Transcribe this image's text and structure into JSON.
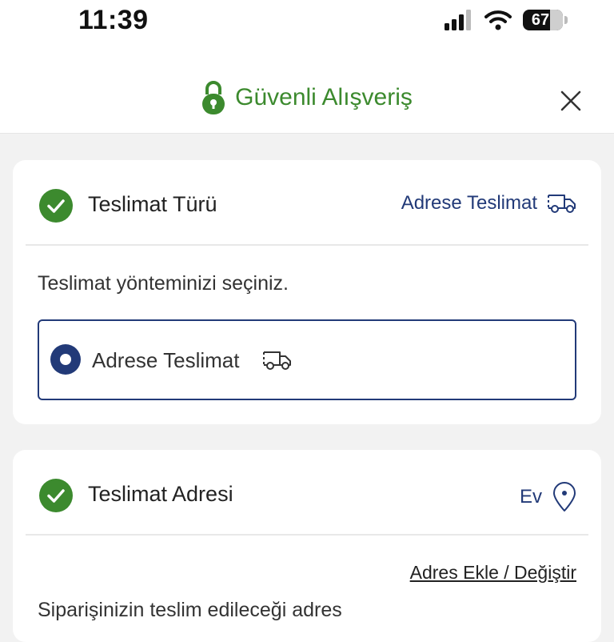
{
  "status_bar": {
    "time": "11:39",
    "battery_level": "67"
  },
  "header": {
    "title": "Güvenli Alışveriş"
  },
  "delivery_type": {
    "title": "Teslimat Türü",
    "selected_summary": "Adrese Teslimat",
    "instruction": "Teslimat yönteminizi seçiniz.",
    "options": [
      {
        "label": "Adrese Teslimat",
        "selected": true
      }
    ]
  },
  "delivery_address": {
    "title": "Teslimat Adresi",
    "selected_summary": "Ev",
    "add_change_link": "Adres Ekle / Değiştir",
    "description": "Siparişinizin teslim edileceği adres"
  },
  "colors": {
    "brand_green": "#3c8a2e",
    "accent_navy": "#223a78",
    "check_green": "#3c8a2e"
  }
}
